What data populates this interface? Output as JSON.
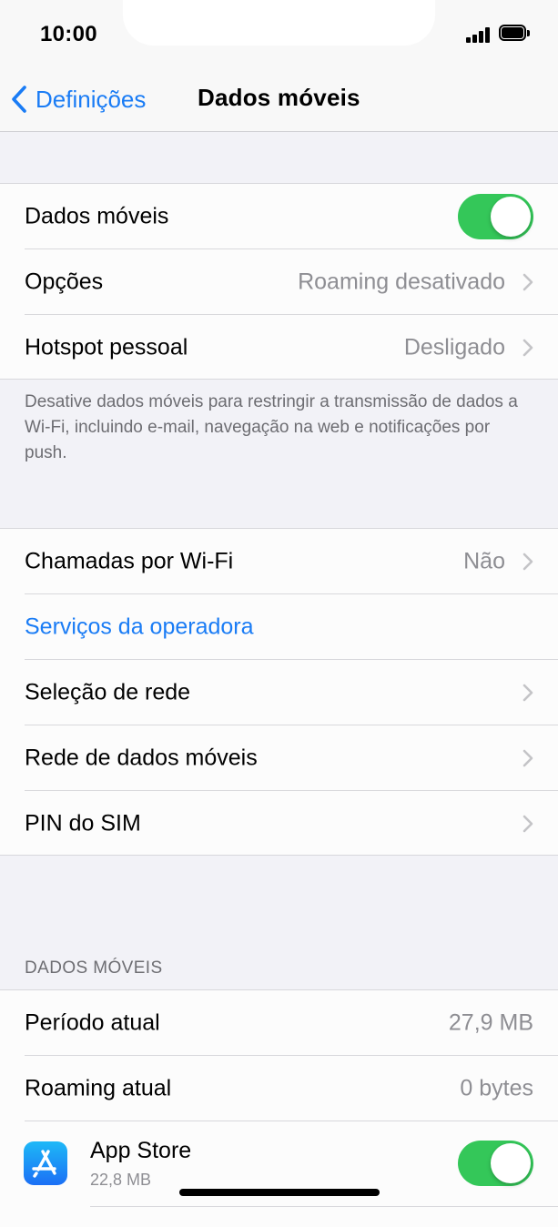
{
  "status_bar": {
    "time": "10:00"
  },
  "nav": {
    "back_label": "Definições",
    "title": "Dados móveis"
  },
  "group1": {
    "mobile_data": {
      "label": "Dados móveis",
      "enabled": true
    },
    "options": {
      "label": "Opções",
      "value": "Roaming desativado"
    },
    "hotspot": {
      "label": "Hotspot pessoal",
      "value": "Desligado"
    }
  },
  "group1_footer": "Desative dados móveis para restringir a transmissão de dados a Wi-Fi, incluindo e-mail, navegação na web e notificações por push.",
  "group2": {
    "wifi_calling": {
      "label": "Chamadas por Wi-Fi",
      "value": "Não"
    },
    "carrier_services": {
      "label": "Serviços da operadora"
    },
    "network_selection": {
      "label": "Seleção de rede"
    },
    "mobile_data_network": {
      "label": "Rede de dados móveis"
    },
    "sim_pin": {
      "label": "PIN do SIM"
    }
  },
  "usage": {
    "header": "DADOS MÓVEIS",
    "current_period": {
      "label": "Período atual",
      "value": "27,9 MB"
    },
    "current_roaming": {
      "label": "Roaming atual",
      "value": "0 bytes"
    },
    "apps": [
      {
        "name": "App Store",
        "size": "22,8 MB",
        "enabled": true,
        "icon": "app-store-icon"
      }
    ]
  },
  "colors": {
    "accent": "#1a7cf5",
    "toggle_on": "#34c759",
    "background": "#f2f2f7",
    "secondary_text": "#8e8e93"
  }
}
